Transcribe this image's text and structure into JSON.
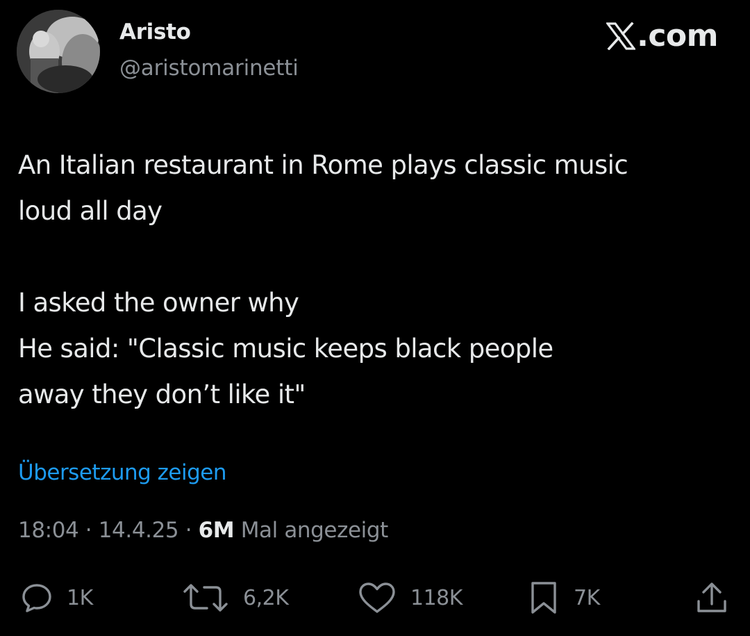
{
  "author": {
    "display_name": "Aristo",
    "handle": "@aristomarinetti"
  },
  "brand": {
    "label": ".com",
    "icon": "x-logo-icon"
  },
  "tweet": {
    "lines": [
      "An Italian restaurant in Rome plays classic music",
      "loud all day",
      "",
      "I asked the owner why",
      "He said:  \"Classic music keeps black people",
      "away they don’t like it\""
    ]
  },
  "translate_link": "Übersetzung zeigen",
  "meta": {
    "time": "18:04",
    "separator": " · ",
    "date": "14.4.25",
    "views_count": "6M",
    "views_label": " Mal angezeigt"
  },
  "actions": [
    {
      "name": "reply",
      "icon": "reply-icon",
      "count": "1K"
    },
    {
      "name": "retweet",
      "icon": "retweet-icon",
      "count": "6,2K"
    },
    {
      "name": "like",
      "icon": "heart-icon",
      "count": "118K"
    },
    {
      "name": "bookmark",
      "icon": "bookmark-icon",
      "count": "7K"
    },
    {
      "name": "share",
      "icon": "share-icon",
      "count": ""
    }
  ],
  "colors": {
    "background": "#000000",
    "text_primary": "#e7e9ea",
    "text_secondary": "#8b9096",
    "link": "#1d9bf0"
  }
}
